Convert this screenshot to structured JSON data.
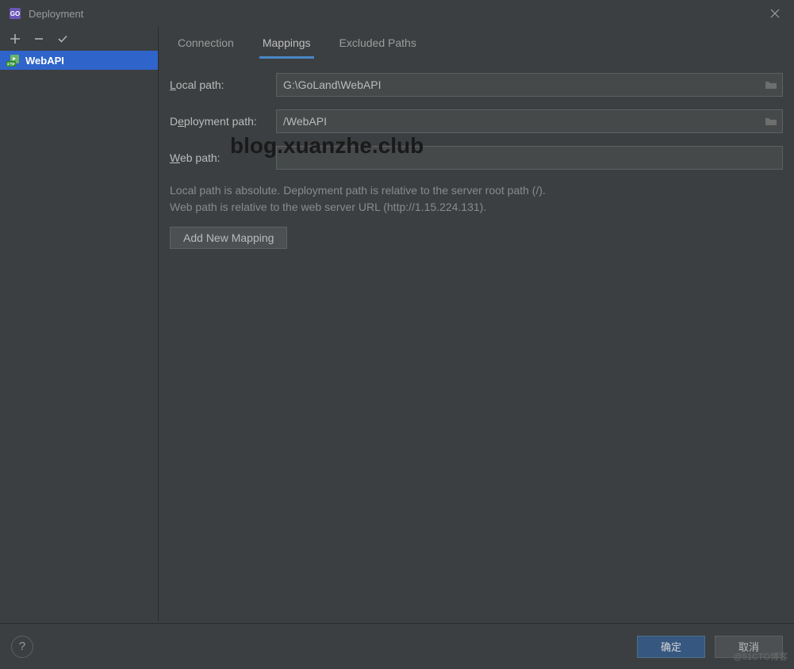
{
  "title": "Deployment",
  "toolbar": {
    "add": "+",
    "remove": "−",
    "check": "✓"
  },
  "sidebar": {
    "servers": [
      {
        "name": "WebAPI",
        "type": "ftp"
      }
    ]
  },
  "tabs": {
    "connection": "Connection",
    "mappings": "Mappings",
    "excluded": "Excluded Paths"
  },
  "form": {
    "local_label_pre": "L",
    "local_label_post": "ocal path:",
    "local_value": "G:\\GoLand\\WebAPI",
    "deploy_label_pre": "D",
    "deploy_label_u": "e",
    "deploy_label_post": "ployment path:",
    "deploy_value": "/WebAPI",
    "web_label_u": "W",
    "web_label_post": "eb path:",
    "web_value": "",
    "help_line1": "Local path is absolute. Deployment path is relative to the server root path (/).",
    "help_line2": "Web path is relative to the web server URL (http://1.15.224.131).",
    "add_mapping_pre": "A",
    "add_mapping_u": "d",
    "add_mapping_post": "d New Mapping"
  },
  "footer": {
    "ok": "确定",
    "cancel": "取消"
  },
  "watermark": {
    "text": "blog.xuanzhe.club",
    "corner": "@51CTO博客"
  }
}
